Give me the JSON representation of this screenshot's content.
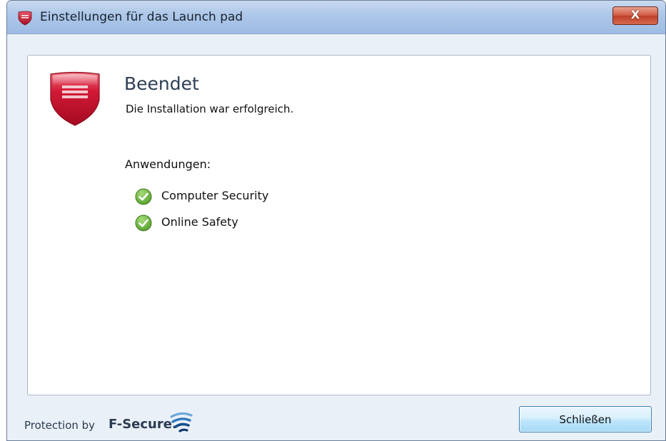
{
  "window": {
    "title": "Einstellungen für das Launch pad",
    "close_glyph": "X",
    "title_icon": "fsecure-shield-icon"
  },
  "main": {
    "heading": "Beendet",
    "subtext": "Die Installation war erfolgreich.",
    "apps_label": "Anwendungen:",
    "applications": [
      {
        "label": "Computer Security",
        "status_icon": "check-circle-icon"
      },
      {
        "label": "Online Safety",
        "status_icon": "check-circle-icon"
      }
    ]
  },
  "footer": {
    "protection_prefix": "Protection by",
    "brand_name": "F-Secure.",
    "close_button_label": "Schließen"
  },
  "colors": {
    "shield_red": "#c8102e",
    "check_green": "#5aa52c",
    "titlebar_blue": "#aec8e8",
    "button_blue": "#bee6fd",
    "close_red": "#c0402a"
  }
}
